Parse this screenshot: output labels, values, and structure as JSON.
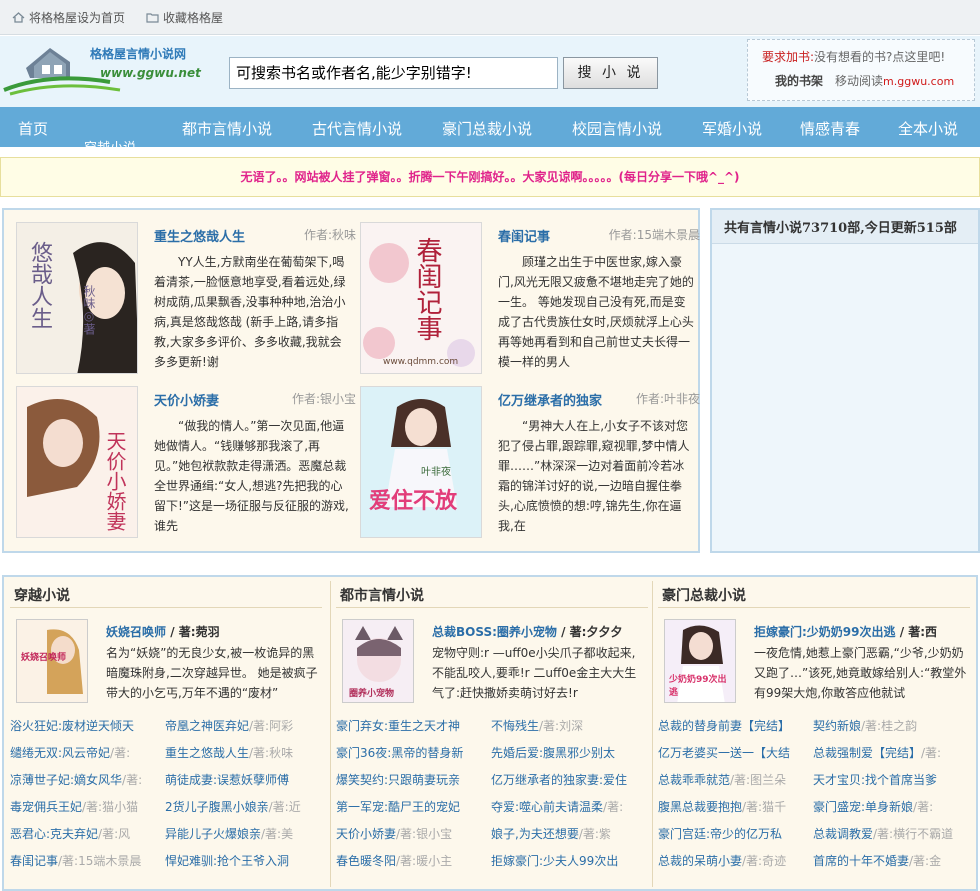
{
  "topbar": {
    "home_link": "将格格屋设为首页",
    "fav_link": "收藏格格屋"
  },
  "logo": {
    "title": "格格屋言情小说网",
    "url": "www.ggwu.net"
  },
  "search": {
    "value": "可搜索书名或作者名,能少字别错字!",
    "button": "搜 小 说"
  },
  "request": {
    "label": "要求加书:",
    "link": "没有想看的书?点这里吧!",
    "shelf": "我的书架",
    "mobile": "移动阅读",
    "domain": "m.ggwu.com"
  },
  "nav": {
    "items": [
      "首页",
      "都市言情小说",
      "古代言情小说",
      "豪门总裁小说",
      "校园言情小说",
      "军婚小说",
      "情感青春",
      "全本小说"
    ],
    "sub": "穿越小说"
  },
  "notice": "无语了。。网站被人挂了弹窗。。折腾一下午刚搞好。。大家见谅啊。。。。。(每日分享一下哦^_^)",
  "featured": [
    {
      "title": "重生之悠哉人生",
      "author": "作者:秋味",
      "cover_text": "悠哉人生",
      "cover_sub": "秋味◎著",
      "desc": "YY人生,方默南坐在葡萄架下,喝着清茶,一脸惬意地享受,看着远处,绿树成荫,瓜果飘香,没事种种地,治治小病,真是悠哉悠哉 (新手上路,请多指教,大家多多评价、多多收藏,我就会多多更新!谢"
    },
    {
      "title": "春闺记事",
      "author": "作者:15端木景晨",
      "cover_text": "春闺记事",
      "cover_sub": "www.qdmm.com",
      "desc": "顾瑾之出生于中医世家,嫁入豪门,风光无限又疲惫不堪地走完了她的一生。 等她发现自己没有死,而是变成了古代贵族仕女时,厌烦就浮上心头 再等她再看到和自己前世丈夫长得一模一样的男人"
    },
    {
      "title": "天价小娇妻",
      "author": "作者:银小宝",
      "cover_text": "天价小娇妻",
      "cover_sub": "",
      "desc": "“做我的情人。”第一次见面,他逼她做情人。“钱赚够那我滚了,再见。”她包袱款款走得潇洒。恶魔总裁全世界通缉:“女人,想逃?先把我的心留下!”这是一场征服与反征服的游戏,谁先"
    },
    {
      "title": "亿万继承者的独家",
      "author": "作者:叶非夜",
      "cover_text": "爱住不放",
      "cover_sub": "叶非夜",
      "desc": "“男神大人在上,小女子不该对您犯了侵占罪,跟踪罪,窥视罪,梦中情人罪……”林深深一边对着面前冷若冰霜的锦洋讨好的说,一边暗自握住拳头,心底愤愤的想:哼,锦先生,你在逼我,在"
    }
  ],
  "stats": {
    "text": "共有言情小说73710部,今日更新515部"
  },
  "columns": [
    {
      "heading": "穿越小说",
      "feature_title": "妖娆召唤师",
      "feature_author": "/ 著:菀羽",
      "feature_desc": "名为“妖娆”的无良少女,被一枚诡异的黑暗魔珠附身,二次穿越异世。 她是被疯子带大的小乞丐,万年不遇的“废材”",
      "cover_text": "妖娆召唤师",
      "rows": [
        [
          {
            "t": "浴火狂妃:废材逆天倾天",
            "a": ""
          },
          {
            "t": "帝凰之神医弃妃",
            "a": "/著:阿彩"
          }
        ],
        [
          {
            "t": "缱绻无双:风云帝妃",
            "a": "/著:"
          },
          {
            "t": "重生之悠哉人生",
            "a": "/著:秋味"
          }
        ],
        [
          {
            "t": "凉薄世子妃:嫡女风华",
            "a": "/著:"
          },
          {
            "t": "萌徒成妻:误惹妖孽师傅",
            "a": ""
          }
        ],
        [
          {
            "t": "毒宠佣兵王妃",
            "a": "/著:猫小猫"
          },
          {
            "t": "2货儿子腹黑小娘亲",
            "a": "/著:近"
          }
        ],
        [
          {
            "t": "恶君心:克夫弃妃",
            "a": "/著:风"
          },
          {
            "t": "异能儿子火爆娘亲",
            "a": "/著:美"
          }
        ],
        [
          {
            "t": "春闺记事",
            "a": "/著:15端木景晨"
          },
          {
            "t": "悍妃难驯:抢个王爷入洞",
            "a": ""
          }
        ]
      ]
    },
    {
      "heading": "都市言情小说",
      "feature_title": "总裁BOSS:圈养小宠物",
      "feature_author": "/ 著:夕夕夕",
      "feature_desc": "宠物守则:r —uff0e小尖爪子都收起来,不能乱咬人,要乖!r 二uff0e金主大大生气了:赶快撒娇卖萌讨好去!r",
      "cover_text": "圈养小宠物",
      "rows": [
        [
          {
            "t": "豪门弃女:重生之天才神",
            "a": ""
          },
          {
            "t": "不悔残生",
            "a": "/著:刘深"
          }
        ],
        [
          {
            "t": "豪门36夜:黑帝的替身新",
            "a": ""
          },
          {
            "t": "先婚后爱:腹黑邪少别太",
            "a": ""
          }
        ],
        [
          {
            "t": "爆笑契约:只跟萌妻玩亲",
            "a": ""
          },
          {
            "t": "亿万继承者的独家妻:爱住",
            "a": ""
          }
        ],
        [
          {
            "t": "第一军宠:酷尸王的宠妃",
            "a": ""
          },
          {
            "t": "夺爱:噬心前夫请温柔",
            "a": "/著:"
          }
        ],
        [
          {
            "t": "天价小娇妻",
            "a": "/著:银小宝"
          },
          {
            "t": "娘子,为夫还想要",
            "a": "/著:紫"
          }
        ],
        [
          {
            "t": "春色暖冬阳",
            "a": "/著:暖小主"
          },
          {
            "t": "拒嫁豪门:少夫人99次出",
            "a": ""
          }
        ]
      ]
    },
    {
      "heading": "豪门总裁小说",
      "feature_title": "拒嫁豪门:少奶奶99次出逃",
      "feature_author": "/ 著:西",
      "feature_desc": "一夜危情,她惹上豪门恶霸,“少爷,少奶奶又跑了…”该死,她竟敢嫁给别人:“教堂外有99架大炮,你敢答应他就试",
      "cover_text": "少奶奶99次出逃",
      "rows": [
        [
          {
            "t": "总裁的替身前妻【完结】",
            "a": ""
          },
          {
            "t": "契约新娘",
            "a": "/著:桂之韵"
          }
        ],
        [
          {
            "t": "亿万老婆买一送一【大结",
            "a": ""
          },
          {
            "t": "总裁强制爱【完结】",
            "a": "/著:"
          }
        ],
        [
          {
            "t": "总裁乖乖就范",
            "a": "/著:图兰朵"
          },
          {
            "t": "天才宝贝:找个首席当爹",
            "a": ""
          }
        ],
        [
          {
            "t": "腹黑总裁要抱抱",
            "a": "/著:猫千"
          },
          {
            "t": "豪门盛宠:单身新娘",
            "a": "/著:"
          }
        ],
        [
          {
            "t": "豪门宫廷:帝少的亿万私",
            "a": ""
          },
          {
            "t": "总裁调教爱",
            "a": "/著:横行不霸道"
          }
        ],
        [
          {
            "t": "总裁的呆萌小妻",
            "a": "/著:奇迹"
          },
          {
            "t": "首席的十年不婚妻",
            "a": "/著:金"
          }
        ]
      ]
    }
  ]
}
